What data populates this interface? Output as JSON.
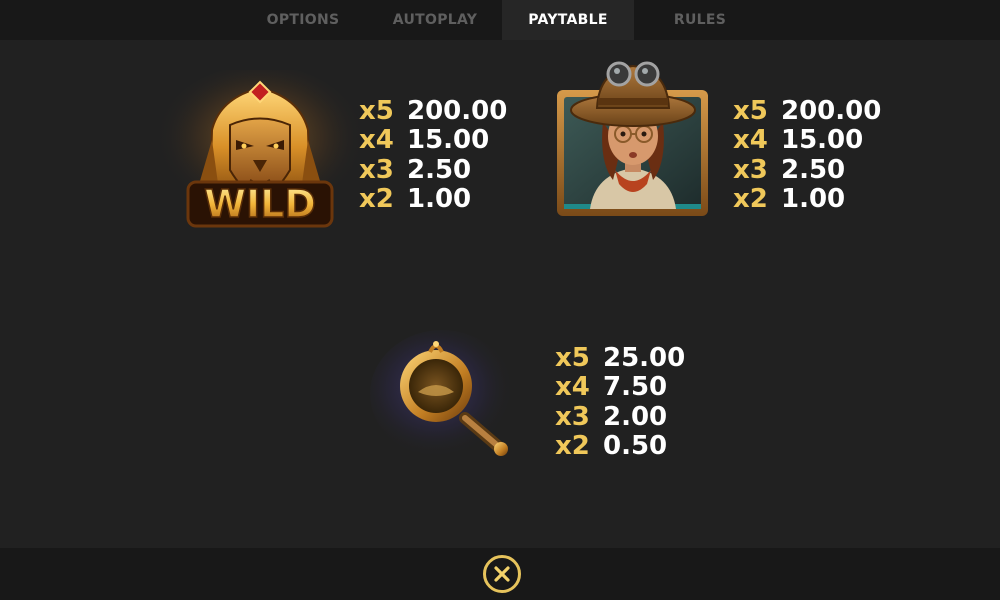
{
  "tabs": [
    {
      "label": "OPTIONS",
      "active": false
    },
    {
      "label": "AUTOPLAY",
      "active": false
    },
    {
      "label": "PAYTABLE",
      "active": true
    },
    {
      "label": "RULES",
      "active": false
    }
  ],
  "symbols": {
    "wild": {
      "badge_text": "WILD",
      "icon": "lion-sphinx-wild-icon",
      "payouts": [
        {
          "mult": "x5",
          "value": "200.00"
        },
        {
          "mult": "x4",
          "value": "15.00"
        },
        {
          "mult": "x3",
          "value": "2.50"
        },
        {
          "mult": "x2",
          "value": "1.00"
        }
      ]
    },
    "explorer": {
      "icon": "explorer-woman-icon",
      "payouts": [
        {
          "mult": "x5",
          "value": "200.00"
        },
        {
          "mult": "x4",
          "value": "15.00"
        },
        {
          "mult": "x3",
          "value": "2.50"
        },
        {
          "mult": "x2",
          "value": "1.00"
        }
      ]
    },
    "magnifier": {
      "icon": "magnifying-glass-icon",
      "payouts": [
        {
          "mult": "x5",
          "value": "25.00"
        },
        {
          "mult": "x4",
          "value": "7.50"
        },
        {
          "mult": "x3",
          "value": "2.00"
        },
        {
          "mult": "x2",
          "value": "0.50"
        }
      ]
    }
  },
  "close_button": {
    "icon": "close-icon"
  },
  "colors": {
    "background": "#212121",
    "bar": "#181818",
    "multiplier": "#f0c85a",
    "value": "#ffffff",
    "accent_gold": "#e6c35c"
  }
}
